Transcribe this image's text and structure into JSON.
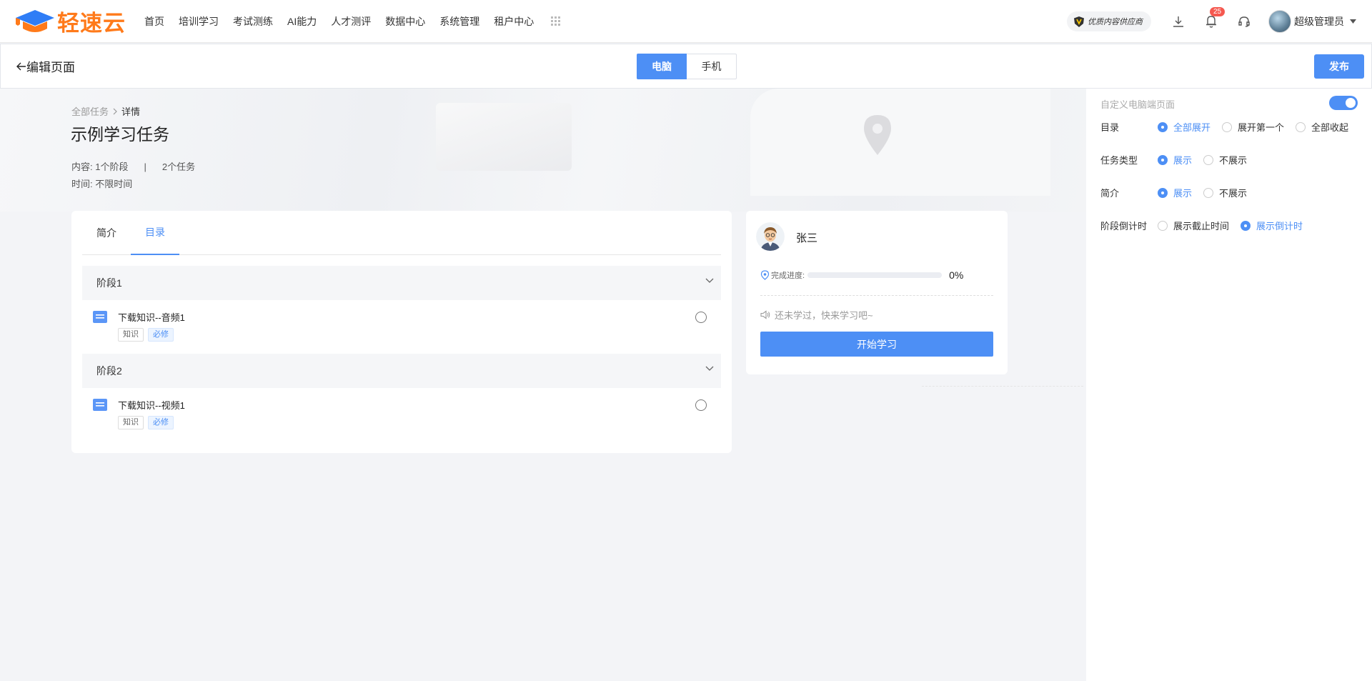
{
  "header": {
    "logo_text": "轻速云",
    "nav": [
      "首页",
      "培训学习",
      "考试测练",
      "AI能力",
      "人才测评",
      "数据中心",
      "系统管理",
      "租户中心"
    ],
    "vendor_badge": "优质内容供应商",
    "notification_count": "25",
    "user_name": "超级管理员"
  },
  "editbar": {
    "back_label": "编辑页面",
    "device_tabs": [
      "电脑",
      "手机"
    ],
    "active_device": "电脑",
    "publish_label": "发布"
  },
  "task": {
    "breadcrumb_root": "全部任务",
    "breadcrumb_current": "详情",
    "title": "示例学习任务",
    "content_label": "内容:",
    "stages_count": "1个阶段",
    "tasks_count": "2个任务",
    "time_label": "时间:",
    "time_value": "不限时间"
  },
  "tabs": [
    "简介",
    "目录"
  ],
  "active_tab": "目录",
  "stages": [
    {
      "name": "阶段1",
      "items": [
        {
          "name": "下载知识--音频1",
          "tags": [
            "知识",
            "必修"
          ]
        }
      ]
    },
    {
      "name": "阶段2",
      "items": [
        {
          "name": "下载知识--视频1",
          "tags": [
            "知识",
            "必修"
          ]
        }
      ]
    }
  ],
  "learner": {
    "name": "张三",
    "progress_label": "完成进度:",
    "progress_value": "0%",
    "progress_fraction": 0,
    "hint": "还未学过，快来学习吧~",
    "start_button": "开始学习"
  },
  "settings": {
    "header": "自定义电脑端页面",
    "toggle_on": true,
    "rows": [
      {
        "label": "目录",
        "options": [
          "全部展开",
          "展开第一个",
          "全部收起"
        ],
        "selected": 0
      },
      {
        "label": "任务类型",
        "options": [
          "展示",
          "不展示"
        ],
        "selected": 0
      },
      {
        "label": "简介",
        "options": [
          "展示",
          "不展示"
        ],
        "selected": 0
      },
      {
        "label": "阶段倒计时",
        "options": [
          "展示截止时间",
          "展示倒计时"
        ],
        "selected": 1
      }
    ]
  },
  "colors": {
    "accent": "#4d8ff5",
    "brand": "#ff7a1a"
  }
}
